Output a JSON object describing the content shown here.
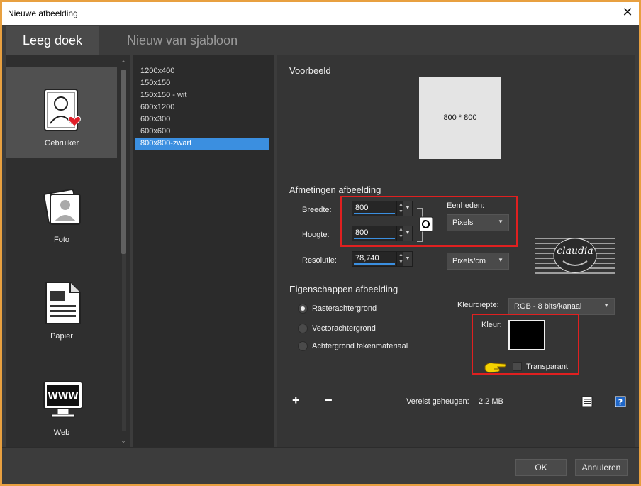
{
  "window": {
    "title": "Nieuwe afbeelding",
    "close_glyph": "✕"
  },
  "tabs": [
    {
      "label": "Leeg doek",
      "active": true
    },
    {
      "label": "Nieuw van sjabloon",
      "active": false
    }
  ],
  "categories": [
    {
      "label": "Gebruiker",
      "icon": "user-heart-icon",
      "selected": true
    },
    {
      "label": "Foto",
      "icon": "photo-icon",
      "selected": false
    },
    {
      "label": "Papier",
      "icon": "paper-icon",
      "selected": false
    },
    {
      "label": "Web",
      "icon": "web-monitor-icon",
      "selected": false
    }
  ],
  "presets": [
    "1200x400",
    "150x150",
    "150x150 - wit",
    "600x1200",
    "600x300",
    "600x600",
    "800x800-zwart"
  ],
  "selected_preset": "800x800-zwart",
  "preview": {
    "title": "Voorbeeld",
    "size_text": "800 * 800"
  },
  "dimensions": {
    "title": "Afmetingen afbeelding",
    "width_label": "Breedte:",
    "width_value": "800",
    "height_label": "Hoogte:",
    "height_value": "800",
    "resolution_label": "Resolutie:",
    "resolution_value": "78,740",
    "units_label": "Eenheden:",
    "units_value": "Pixels",
    "res_units_value": "Pixels/cm",
    "watermark_text": "claudia"
  },
  "properties": {
    "title": "Eigenschappen afbeelding",
    "radio_options": [
      {
        "label": "Rasterachtergrond",
        "checked": true
      },
      {
        "label": "Vectorachtergrond",
        "checked": false
      },
      {
        "label": "Achtergrond tekenmateriaal",
        "checked": false
      }
    ],
    "depth_label": "Kleurdiepte:",
    "depth_value": "RGB - 8 bits/kanaal",
    "color_label": "Kleur:",
    "color_value": "#000000",
    "transparent_label": "Transparant"
  },
  "memory": {
    "label": "Vereist geheugen:",
    "value": "2,2 MB"
  },
  "buttons": {
    "ok": "OK",
    "cancel": "Annuleren",
    "plus": "+",
    "minus": "−"
  },
  "colors": {
    "accent": "#3b8fe0",
    "highlight_box": "#e02020",
    "frame": "#e8a040"
  }
}
